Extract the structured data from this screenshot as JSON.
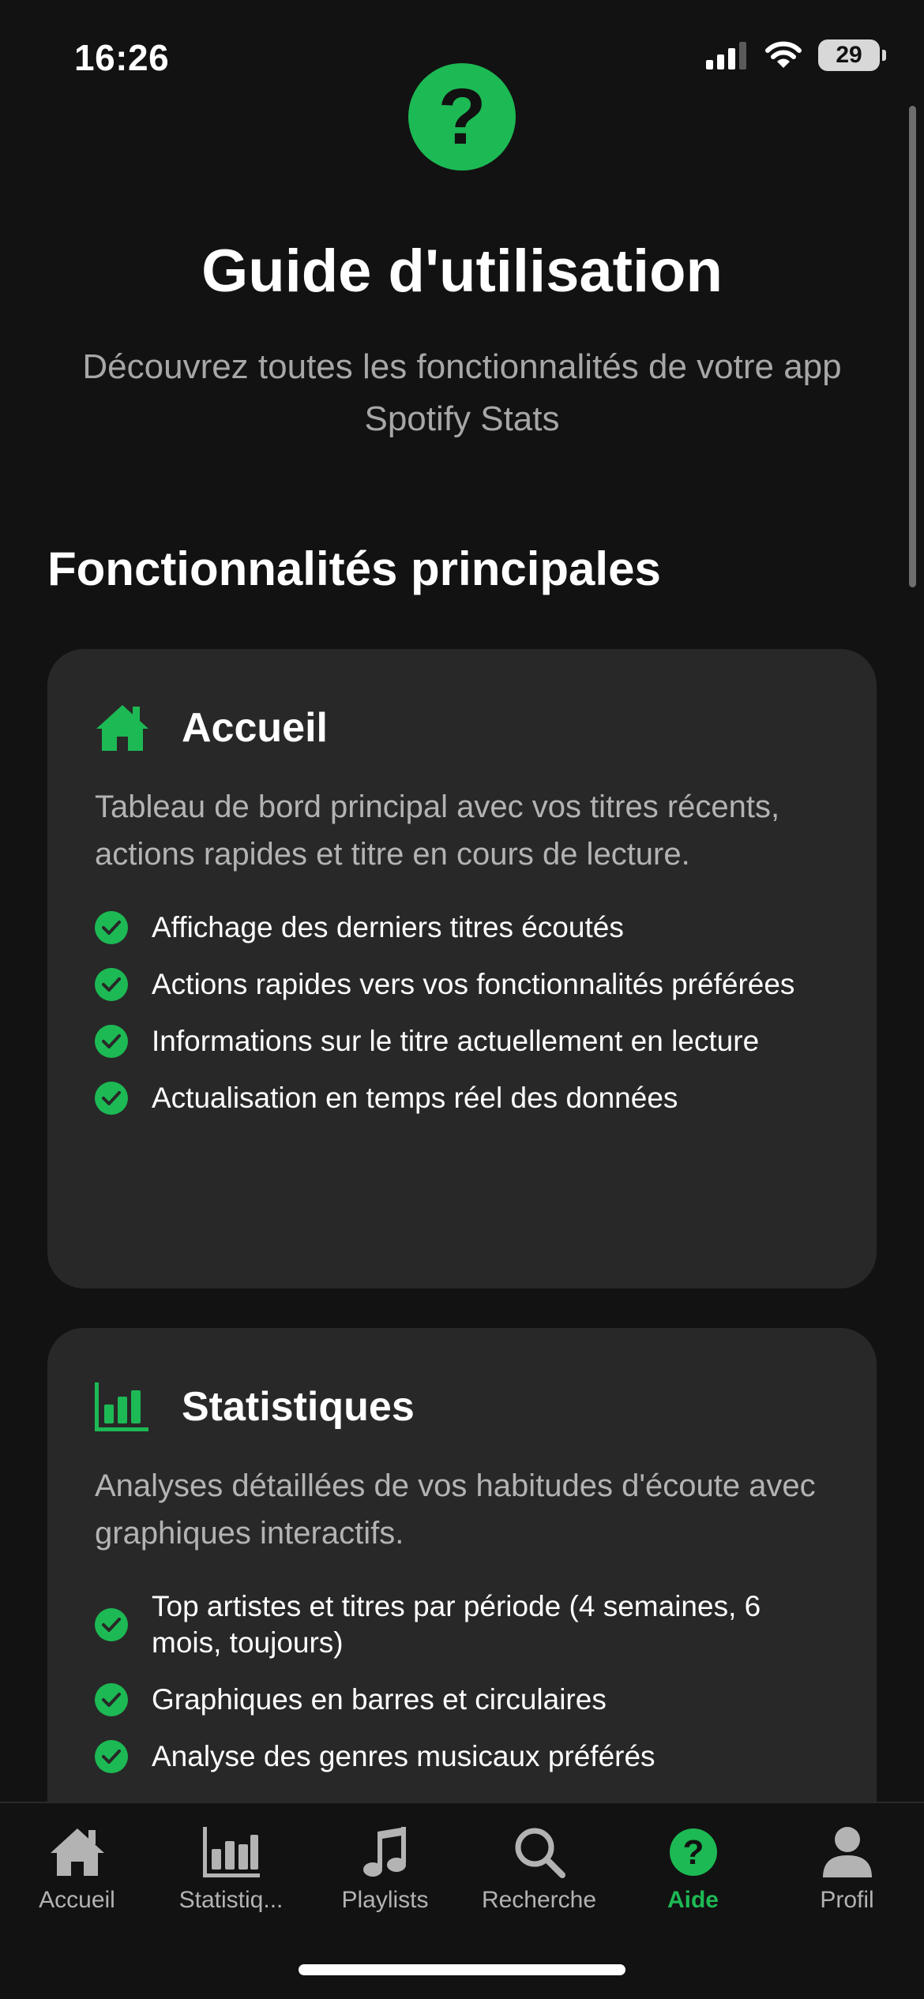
{
  "status_bar": {
    "time": "16:26",
    "battery": "29"
  },
  "header": {
    "icon": "question-mark-icon",
    "title": "Guide d'utilisation",
    "subtitle": "Découvrez toutes les fonctionnalités de votre app Spotify Stats"
  },
  "main": {
    "section_title": "Fonctionnalités principales",
    "cards": [
      {
        "icon": "home-icon",
        "title": "Accueil",
        "description": "Tableau de bord principal avec vos titres récents, actions rapides et titre en cours de lecture.",
        "features": [
          "Affichage des derniers titres écoutés",
          "Actions rapides vers vos fonctionnalités préférées",
          "Informations sur le titre actuellement en lecture",
          "Actualisation en temps réel des données"
        ]
      },
      {
        "icon": "bar-chart-icon",
        "title": "Statistiques",
        "description": "Analyses détaillées de vos habitudes d'écoute avec graphiques interactifs.",
        "features": [
          "Top artistes et titres par période (4 semaines, 6 mois, toujours)",
          "Graphiques en barres et circulaires",
          "Analyse des genres musicaux préférés"
        ]
      }
    ]
  },
  "tab_bar": {
    "active_index": 4,
    "tabs": [
      {
        "label": "Accueil",
        "icon": "home-icon"
      },
      {
        "label": "Statistiq...",
        "icon": "bar-chart-icon"
      },
      {
        "label": "Playlists",
        "icon": "music-note-icon"
      },
      {
        "label": "Recherche",
        "icon": "search-icon"
      },
      {
        "label": "Aide",
        "icon": "help-icon"
      },
      {
        "label": "Profil",
        "icon": "person-icon"
      }
    ]
  },
  "colors": {
    "accent": "#1DB954",
    "background": "#121212",
    "card": "#282828",
    "muted_text": "#A7A7A7"
  }
}
